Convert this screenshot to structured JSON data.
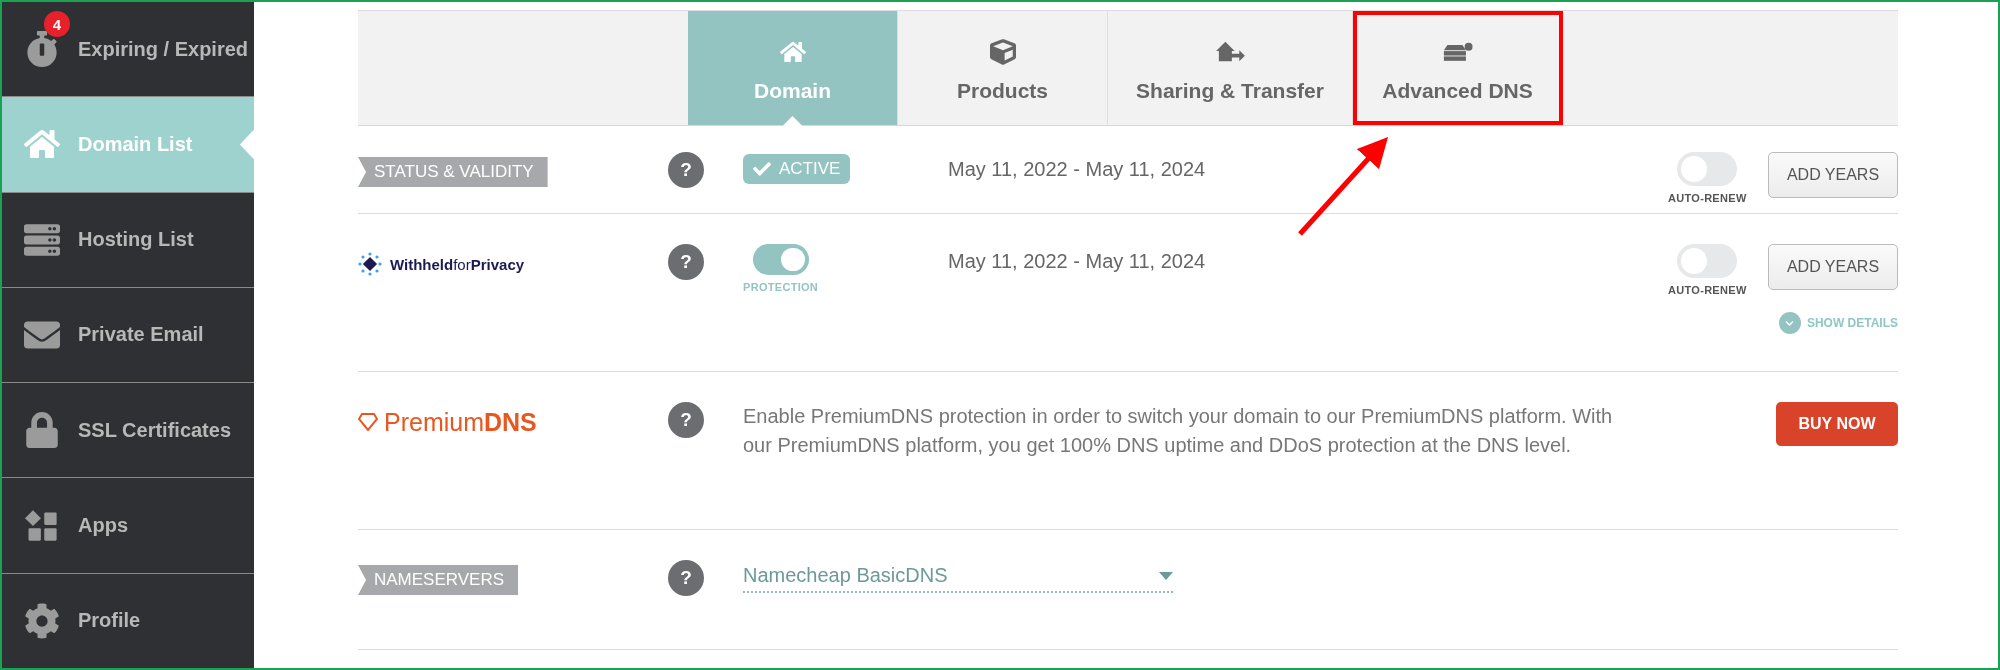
{
  "sidebar": {
    "items": [
      {
        "label": "Expiring / Expired",
        "selected": false,
        "badge": "4"
      },
      {
        "label": "Domain List",
        "selected": true
      },
      {
        "label": "Hosting List",
        "selected": false
      },
      {
        "label": "Private Email",
        "selected": false
      },
      {
        "label": "SSL Certificates",
        "selected": false
      },
      {
        "label": "Apps",
        "selected": false
      },
      {
        "label": "Profile",
        "selected": false
      }
    ]
  },
  "tabs": [
    {
      "label": "Domain",
      "selected": true,
      "highlighted": false
    },
    {
      "label": "Products",
      "selected": false,
      "highlighted": false
    },
    {
      "label": "Sharing & Transfer",
      "selected": false,
      "highlighted": false
    },
    {
      "label": "Advanced DNS",
      "selected": false,
      "highlighted": true
    }
  ],
  "rows": [
    {
      "kind": "status",
      "label": "STATUS & VALIDITY",
      "help": "?",
      "status": "ACTIVE",
      "dates": "May 11, 2022 - May 11, 2024",
      "auto_renew": {
        "label": "AUTO-RENEW",
        "on": false
      },
      "button": "ADD YEARS"
    },
    {
      "kind": "privacy",
      "logo": "**Withheld**for**Privacy**",
      "help": "?",
      "protection": {
        "label": "PROTECTION",
        "on": true
      },
      "dates": "May 11, 2022 - May 11, 2024",
      "auto_renew": {
        "label": "AUTO-RENEW",
        "on": false
      },
      "button": "ADD YEARS",
      "link": "SHOW DETAILS"
    },
    {
      "kind": "premium",
      "logo": "Premium**DNS**",
      "help": "?",
      "description": "Enable PremiumDNS protection in order to switch your domain to our PremiumDNS platform. With our PremiumDNS platform, you get 100% DNS uptime and DDoS protection at the DNS level.",
      "button": "BUY NOW"
    },
    {
      "kind": "nameservers",
      "label": "NAMESERVERS",
      "help": "?",
      "value": "Namecheap BasicDNS"
    }
  ]
}
